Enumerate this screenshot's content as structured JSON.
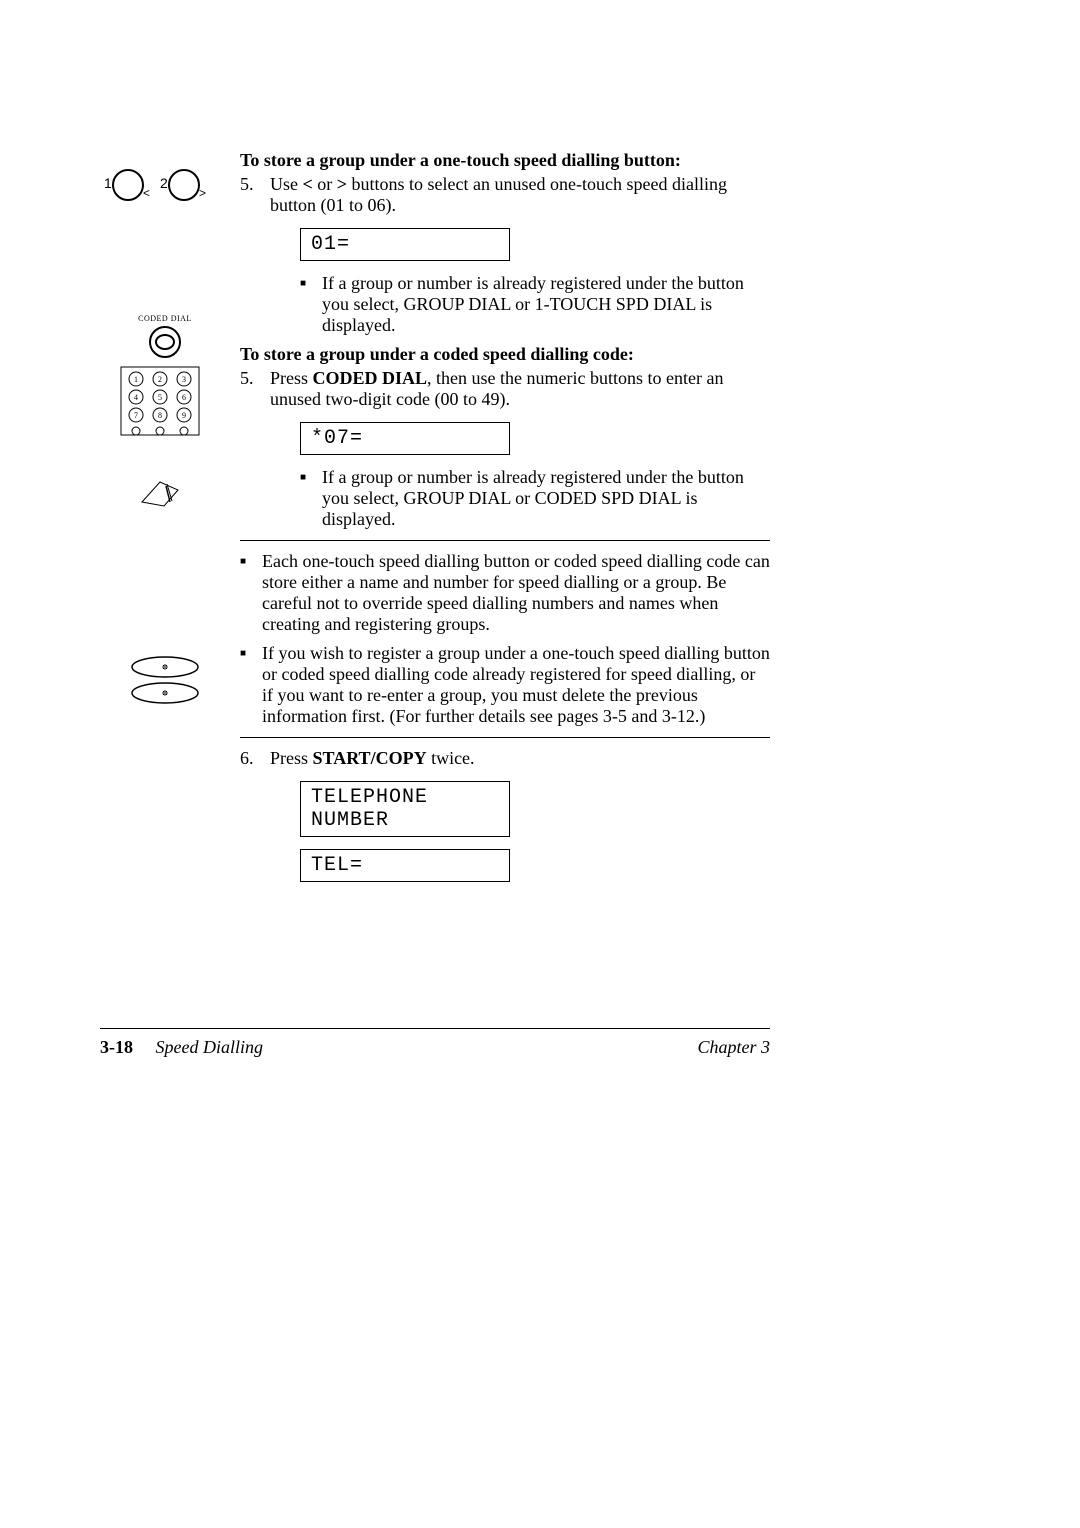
{
  "icons": {
    "coded_dial_label": "CODED DIAL"
  },
  "section1": {
    "heading": "To store a group under a one-touch speed dialling button:",
    "step_num": "5.",
    "step_text_pre": "Use ",
    "step_text_lt": "<",
    "step_text_mid": " or ",
    "step_text_gt": ">",
    "step_text_post": " buttons to select an unused one-touch speed dialling button (01 to 06).",
    "display": "01=",
    "bullet": "If a group or number is already registered under the button you select, GROUP DIAL or 1-TOUCH SPD DIAL is displayed."
  },
  "section2": {
    "heading": "To store a group under a coded speed dialling code:",
    "step_num": "5.",
    "step_text_pre": "Press ",
    "step_text_bold": "CODED DIAL",
    "step_text_post": ", then use the numeric buttons to enter an unused two-digit code (00 to 49).",
    "display": "*07=",
    "bullet": "If a group or number is already registered under the button you select, GROUP DIAL or CODED SPD DIAL is displayed."
  },
  "note": {
    "bullet1": "Each one-touch speed dialling button or coded speed dialling code can store either a name and number for speed dialling or a group. Be careful not to override speed dialling numbers and names when creating and registering groups.",
    "bullet2": "If you wish to register a group under a one-touch speed dialling button or coded speed dialling code already registered for speed dialling, or if you want to re-enter a group, you must delete the previous information first. (For further details see pages 3-5 and 3-12.)"
  },
  "section3": {
    "step_num": "6.",
    "step_text_pre": "Press ",
    "step_text_bold": "START/COPY",
    "step_text_post": " twice.",
    "display1": "TELEPHONE NUMBER",
    "display2": "TEL="
  },
  "footer": {
    "page_num": "3-18",
    "section_title": "Speed Dialling",
    "chapter": "Chapter 3"
  }
}
